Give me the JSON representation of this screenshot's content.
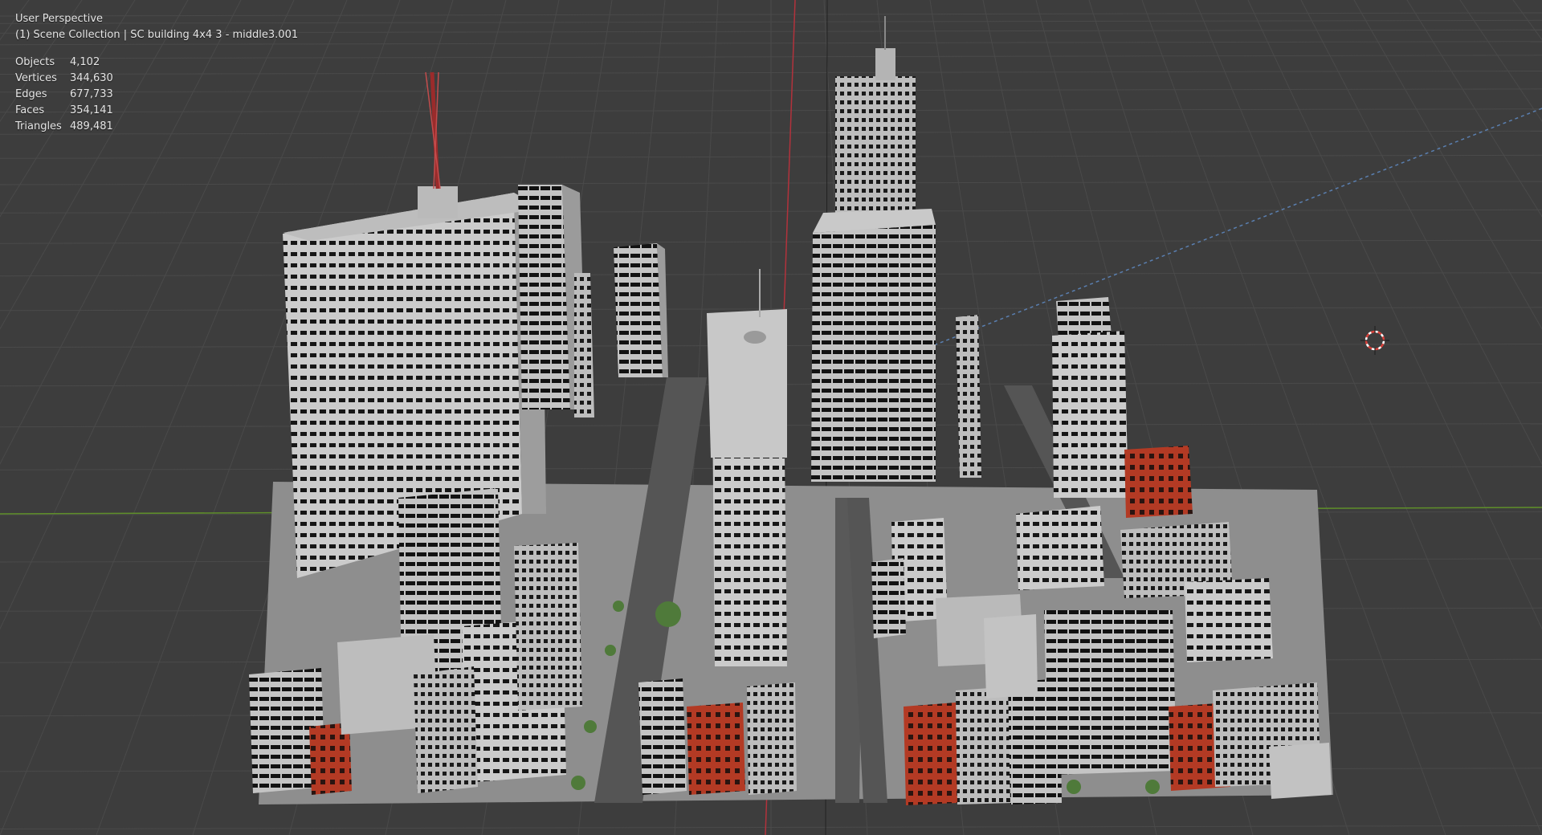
{
  "viewport": {
    "view_name": "User Perspective",
    "collection_line": "(1) Scene Collection | SC building 4x4 3 - middle3.001"
  },
  "stats": [
    {
      "label": "Objects",
      "value": "4,102"
    },
    {
      "label": "Vertices",
      "value": "344,630"
    },
    {
      "label": "Edges",
      "value": "677,733"
    },
    {
      "label": "Faces",
      "value": "354,141"
    },
    {
      "label": "Triangles",
      "value": "489,481"
    }
  ],
  "colors": {
    "background": "#3d3d3d",
    "grid": "#4a4a4a",
    "x_axis": "#b2323c",
    "y_axis": "#5f8f2a",
    "building": "#c9c9c9",
    "building_shade": "#a9a9a9",
    "window": "#151515",
    "brick": "#b33a24",
    "road": "#555555",
    "tree": "#4f7a3a"
  },
  "icons": {
    "cursor": "3d-cursor-icon"
  }
}
